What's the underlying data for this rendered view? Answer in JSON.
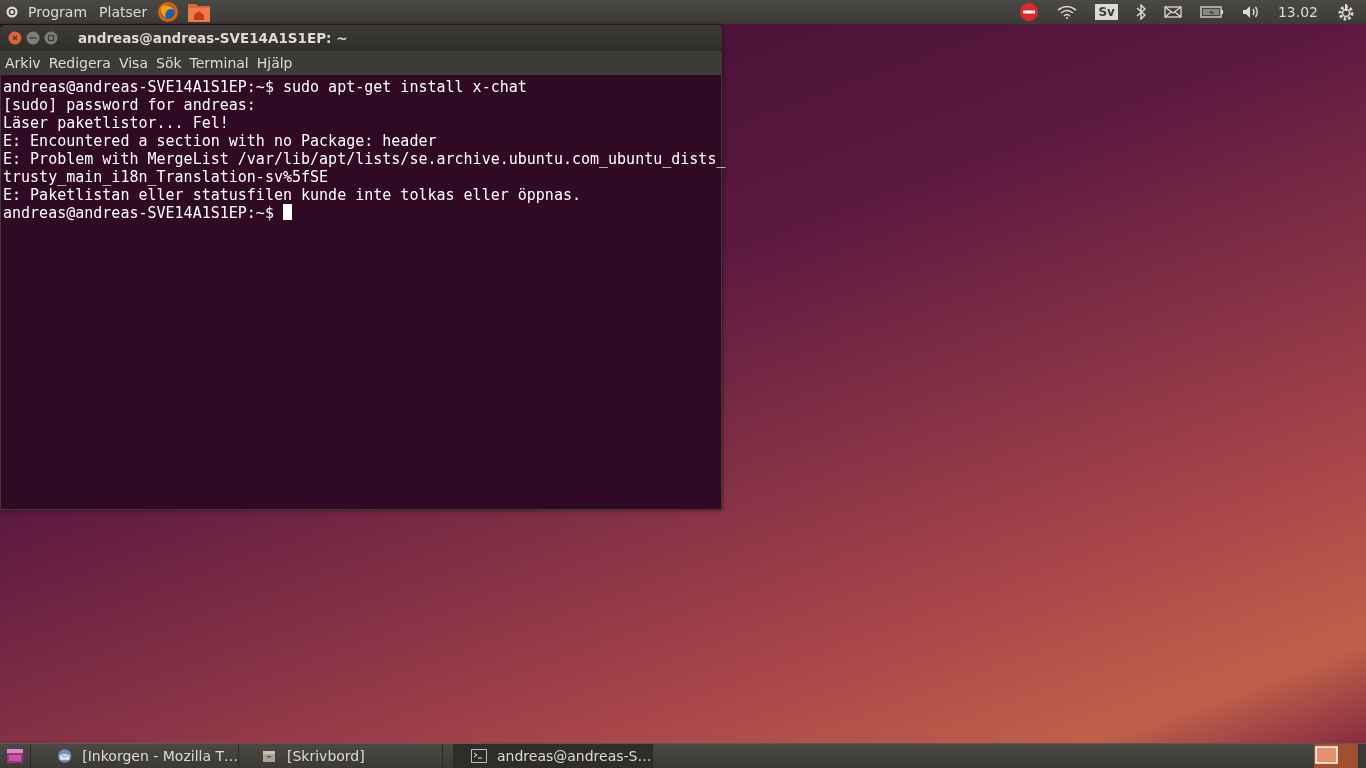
{
  "top_panel": {
    "menus": [
      "Program",
      "Platser"
    ],
    "keyboard_layout": "Sv",
    "clock": "13.02"
  },
  "terminal": {
    "title": "andreas@andreas-SVE14A1S1EP: ~",
    "menu": [
      "Arkiv",
      "Redigera",
      "Visa",
      "Sök",
      "Terminal",
      "Hjälp"
    ],
    "lines": [
      "andreas@andreas-SVE14A1S1EP:~$ sudo apt-get install x-chat",
      "[sudo] password for andreas:",
      "Läser paketlistor... Fel!",
      "E: Encountered a section with no Package: header",
      "E: Problem with MergeList /var/lib/apt/lists/se.archive.ubuntu.com_ubuntu_dists_",
      "trusty_main_i18n_Translation-sv%5fSE",
      "E: Paketlistan eller statusfilen kunde inte tolkas eller öppnas."
    ],
    "prompt": "andreas@andreas-SVE14A1S1EP:~$ "
  },
  "taskbar": {
    "items": [
      {
        "kind": "mail",
        "label": "[Inkorgen - Mozilla T…",
        "selected": false
      },
      {
        "kind": "desktop",
        "label": "[Skrivbord]",
        "selected": false
      },
      {
        "kind": "terminal",
        "label": "andreas@andreas-S…",
        "selected": true
      }
    ]
  }
}
